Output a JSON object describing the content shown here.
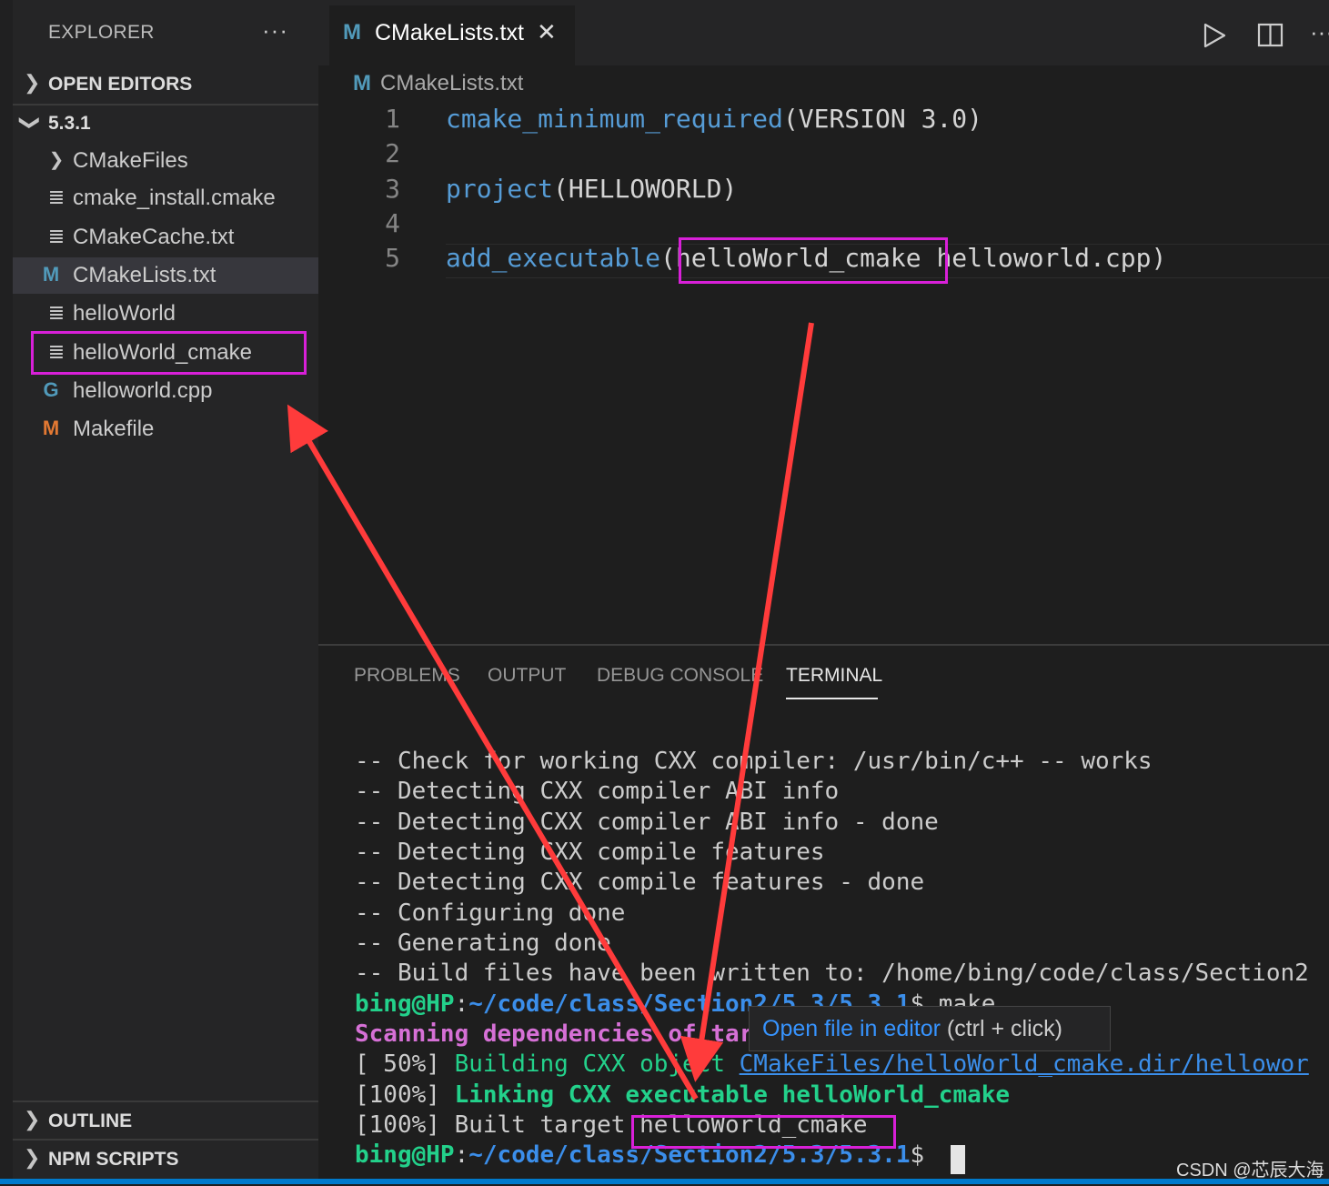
{
  "sidebar": {
    "title": "EXPLORER",
    "more": "···",
    "open_editors": "OPEN EDITORS",
    "folder": "5.3.1",
    "items": [
      {
        "label": "CMakeFiles",
        "icon": "chevron-right-icon"
      },
      {
        "label": "cmake_install.cmake",
        "icon": "file-lines-icon"
      },
      {
        "label": "CMakeCache.txt",
        "icon": "file-lines-icon"
      },
      {
        "label": "CMakeLists.txt",
        "icon": "cmake-m-icon"
      },
      {
        "label": "helloWorld",
        "icon": "file-lines-icon"
      },
      {
        "label": "helloWorld_cmake",
        "icon": "file-lines-icon"
      },
      {
        "label": "helloworld.cpp",
        "icon": "cpp-icon"
      },
      {
        "label": "Makefile",
        "icon": "makefile-m-icon"
      }
    ],
    "outline": "OUTLINE",
    "npm_scripts": "NPM SCRIPTS"
  },
  "editor": {
    "tab_label": "CMakeLists.txt",
    "tab_icon": "M",
    "breadcrumb": "CMakeLists.txt",
    "lines": [
      {
        "n": "1",
        "fn": "cmake_minimum_required",
        "rest": "(VERSION 3.0)"
      },
      {
        "n": "2",
        "fn": "",
        "rest": ""
      },
      {
        "n": "3",
        "fn": "project",
        "rest": "(HELLOWORLD)"
      },
      {
        "n": "4",
        "fn": "",
        "rest": ""
      },
      {
        "n": "5",
        "fn": "add_executable",
        "open": "(",
        "arg1": "helloWorld_cmake",
        "arg2": "helloworld.cpp",
        "close": ")"
      }
    ]
  },
  "panel": {
    "tabs": [
      "PROBLEMS",
      "OUTPUT",
      "DEBUG CONSOLE",
      "TERMINAL"
    ],
    "terminal_lines": [
      "-- Check for working CXX compiler: /usr/bin/c++ -- works",
      "-- Detecting CXX compiler ABI info",
      "-- Detecting CXX compiler ABI info - done",
      "-- Detecting CXX compile features",
      "-- Detecting CXX compile features - done",
      "-- Configuring done",
      "-- Generating done",
      "-- Build files have been written to: /home/bing/code/class/Section2"
    ],
    "prompt_user": "bing@HP",
    "prompt_path": "~/code/class/Section2/5.3/5.3.1",
    "prompt_cmd": "$ make",
    "scanning": "Scanning dependencies of target helloWorld_cmake",
    "build_pct": "[ 50%]",
    "build_text": "Building CXX object",
    "build_link": "CMakeFiles/helloWorld_cmake.dir/hellowor",
    "link_pct": "[100%]",
    "link_text": "Linking CXX executable helloWorld_cmake",
    "built_pct": "[100%]",
    "built_text": "Built target",
    "built_target": "helloWorld_cmake",
    "final_prompt_suffix": "$",
    "hover_link": "Open file in editor",
    "hover_hint": "(ctrl + click)"
  },
  "toolbar": {
    "run_icon": "play-icon",
    "split_icon": "split-editor-icon",
    "more": "···"
  },
  "watermark": "CSDN @芯辰大海",
  "colors": {
    "annotation": "#d820d8",
    "arrow": "#ff3b3b",
    "accent": "#007acc"
  }
}
